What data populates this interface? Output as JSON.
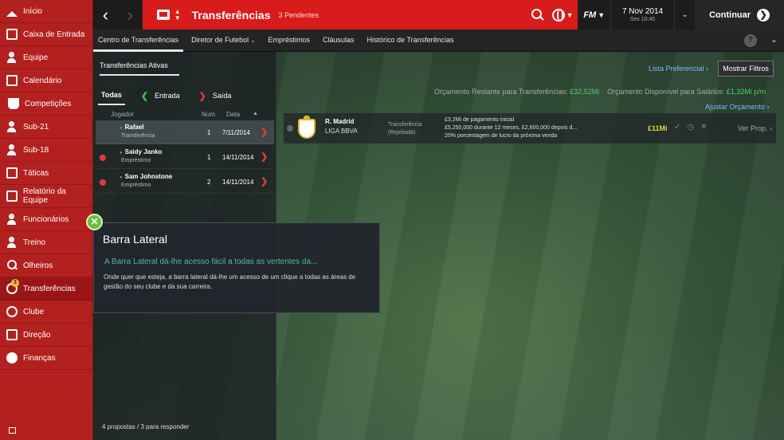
{
  "sidebar": {
    "items": [
      {
        "label": "Início",
        "icon": "house-icon"
      },
      {
        "label": "Caixa de Entrada",
        "icon": "inbox-icon"
      },
      {
        "label": "Equipe",
        "icon": "team-icon"
      },
      {
        "label": "Calendário",
        "icon": "calendar-icon"
      },
      {
        "label": "Competições",
        "icon": "trophy-icon"
      },
      {
        "label": "Sub-21",
        "icon": "team-icon"
      },
      {
        "label": "Sub-18",
        "icon": "team-icon"
      },
      {
        "label": "Táticas",
        "icon": "tactics-icon"
      },
      {
        "label": "Relatório da Equipe",
        "icon": "report-icon"
      },
      {
        "label": "Funcionários",
        "icon": "staff-icon"
      },
      {
        "label": "Treino",
        "icon": "training-icon"
      },
      {
        "label": "Olheiros",
        "icon": "search-icon"
      },
      {
        "label": "Transferências",
        "icon": "transfers-icon",
        "badge": "3"
      },
      {
        "label": "Clube",
        "icon": "club-icon"
      },
      {
        "label": "Direção",
        "icon": "board-icon"
      },
      {
        "label": "Finanças",
        "icon": "finance-icon"
      }
    ]
  },
  "header": {
    "title": "Transferências",
    "pending": "3 Pendentes",
    "logo": "FM",
    "date": "7 Nov 2014",
    "time": "Sex 10:45",
    "continue_label": "Continuar"
  },
  "subnav": {
    "tabs": [
      "Centro de Transferências",
      "Diretor de Futebol",
      "Empréstimos",
      "Cláusulas",
      "Histórico de Transferências"
    ],
    "help": "?"
  },
  "left": {
    "tab": "Transferências Ativas",
    "filters": [
      "Todas",
      "Entrada",
      "Saída"
    ],
    "columns": [
      "Jogador",
      "Num",
      "Data"
    ],
    "rows": [
      {
        "name": "Rafael",
        "type": "Transferência",
        "num": "1",
        "date": "7/11/2014"
      },
      {
        "name": "Saidy Janko",
        "type": "Empréstimo",
        "num": "1",
        "date": "14/11/2014"
      },
      {
        "name": "Sam Johnstone",
        "type": "Empréstimo",
        "num": "2",
        "date": "14/11/2014"
      }
    ],
    "footer": "4 propostas / 3 para responder"
  },
  "right": {
    "pref_link": "Lista Preferencial",
    "filters_button": "Mostrar Filtros",
    "budget_transfer_label": "Orçamento Restante para Transferências:",
    "budget_transfer_value": "£32,52Mi",
    "budget_wage_label": "Orçamento Disponível para Salários:",
    "budget_wage_value": "£1,32Mi p/m",
    "adjust_link": "Ajustar Orçamento",
    "offer": {
      "club": "R. Madrid",
      "league": "LIGA BBVA",
      "status_line1": "Transferência",
      "status_line2": "(Rejeitada)",
      "terms_line1": "£3,2Mi de pagamento inicial",
      "terms_line2": "£5,250,000 durante 12 meses, £2,600,000 depois d...",
      "terms_line3": "20% porcentagem de lucro da próxima venda",
      "fee": "£11Mi",
      "view": "Ver Prop."
    }
  },
  "tooltip": {
    "title": "Barra Lateral",
    "subtitle": "A Barra Lateral dá-lhe acesso fácil a todas as vertentes da...",
    "body": "Onde quer que esteja, a barra lateral dá-lhe um acesso de um clique a todas as áreas de gestão do seu clube e da sua carreira."
  }
}
